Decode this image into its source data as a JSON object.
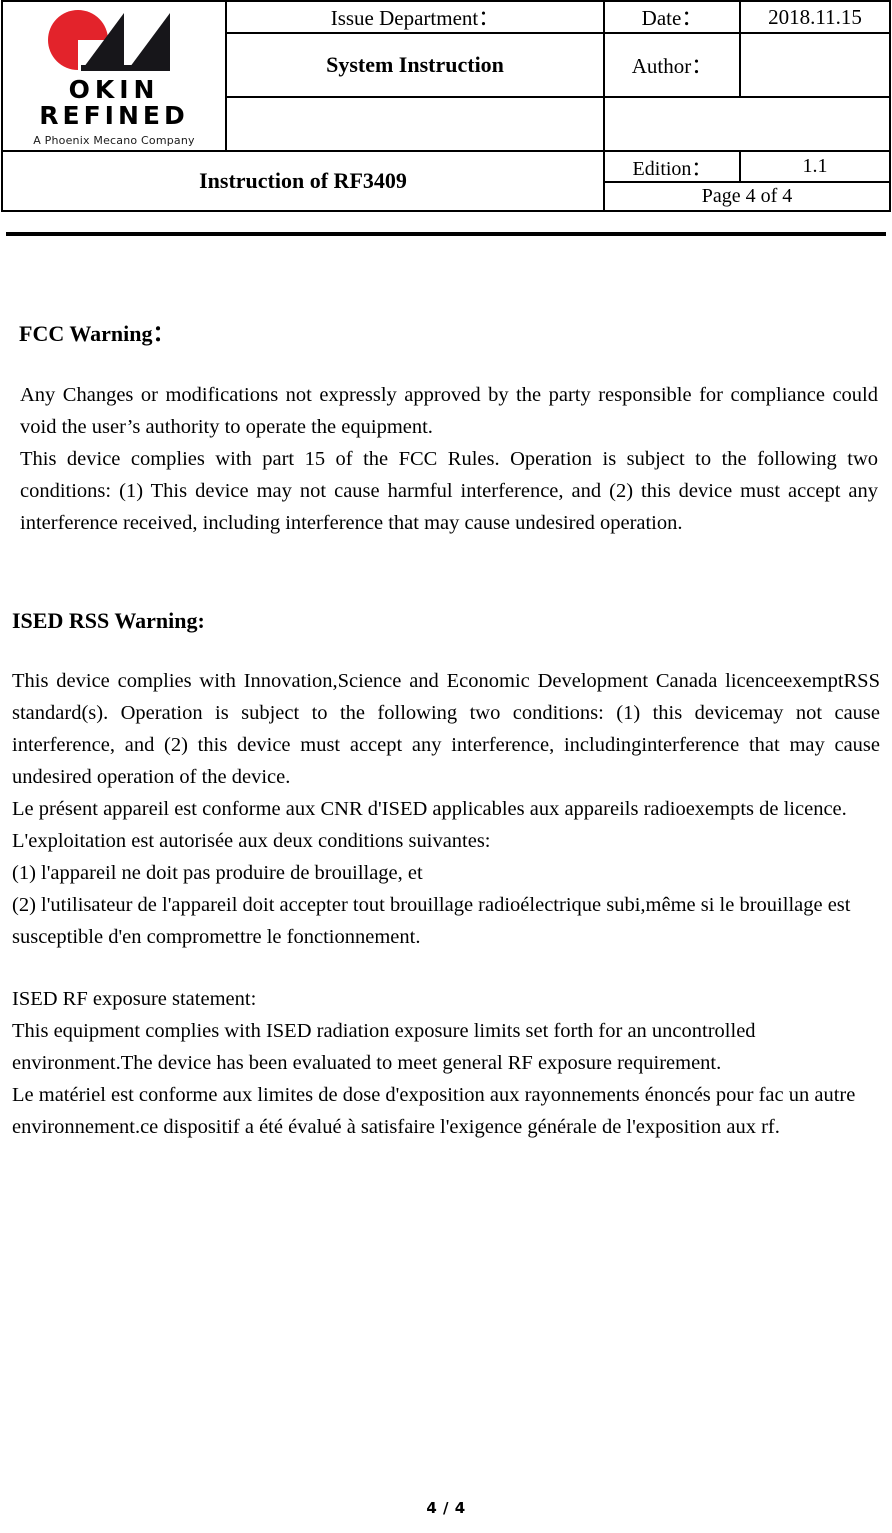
{
  "header": {
    "logo": {
      "mark_name": "okin-logo-mark",
      "red_hex": "#E3232B",
      "black_hex": "#17161A",
      "line1": "OKIN",
      "line2": "REFINED",
      "tagline": "A Phoenix Mecano Company"
    },
    "issue_department_label": "Issue Department：",
    "date_label": "Date：",
    "date_value": "2018.11.15",
    "system_instruction_label": "System Instruction",
    "author_label": "Author：",
    "author_value": "",
    "blank_left": "",
    "blank_right": "",
    "instruction_title": "Instruction of RF3409",
    "edition_label": "Edition：",
    "edition_value": "1.1",
    "page_label": "Page 4 of 4"
  },
  "fcc": {
    "title": "FCC Warning：",
    "para1": "Any Changes or modifications not expressly approved by the party responsible for compliance could void the user’s authority to operate the equipment.",
    "para2": "This device complies with part 15 of the FCC Rules. Operation is subject to the following two conditions: (1) This device may not cause harmful interference, and (2) this device must accept any interference received, including interference that may cause undesired operation."
  },
  "ised": {
    "title": "ISED RSS Warning:",
    "para1": "This device complies with Innovation,Science and Economic Development Canada licenceexemptRSS standard(s). Operation is subject to the following two conditions: (1) this devicemay not cause interference, and (2) this device must accept any interference, includinginterference that may cause undesired operation of the device.",
    "para2": "Le présent appareil est conforme aux CNR d'ISED applicables aux appareils radioexempts de licence.",
    "para3": "L'exploitation est autorisée aux deux conditions suivantes:",
    "para4": "(1) l'appareil ne doit pas produire de brouillage, et",
    "para5": "(2) l'utilisateur de l'appareil doit accepter tout brouillage radioélectrique subi,même si le brouillage est susceptible d'en compromettre le fonctionnement."
  },
  "exposure": {
    "title": "ISED RF exposure statement:",
    "para1": "This equipment complies with ISED radiation exposure limits set forth for an uncontrolled environment.The device has been evaluated to meet general RF exposure requirement.",
    "para2": "Le matériel est conforme aux limites de dose d'exposition aux rayonnements énoncés pour fac un autre environnement.ce dispositif a été évalué à satisfaire l'exigence générale de l'exposition aux rf."
  },
  "footer": {
    "page_number": "4 / 4"
  }
}
